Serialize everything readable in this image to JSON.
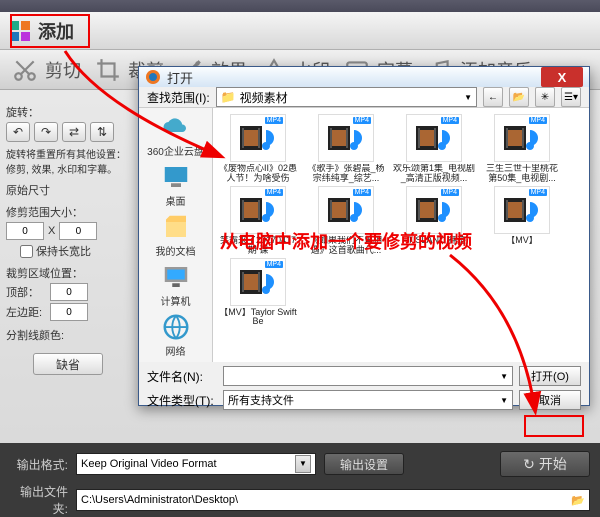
{
  "app": {
    "add_label": "添加",
    "tools": [
      "剪切",
      "裁剪",
      "效果",
      "水印",
      "字幕",
      "添加音乐"
    ],
    "left_panel": {
      "rotate_label": "旋转：",
      "note": "旋转将重置所有其他设置：修剪, 效果, 水印和字幕。",
      "orig_size": "原始尺寸",
      "crop_size": "修剪范围大小：",
      "w": "0",
      "x_sep": "X",
      "h": "0",
      "keep_ratio": "保持长宽比",
      "crop_pos": "裁剪区域位置：",
      "top": "顶部：",
      "top_v": "0",
      "left": "左边距:",
      "left_v": "0",
      "split_color": "分割线颜色:",
      "default_btn": "缺省"
    },
    "bottom": {
      "fmt_label": "输出格式:",
      "fmt_value": "Keep Original Video Format",
      "settings_btn": "输出设置",
      "start_btn": "开始",
      "out_label": "输出文件夹:",
      "out_path": "C:\\Users\\Administrator\\Desktop\\"
    }
  },
  "dialog": {
    "title": "打开",
    "lookin": "查找范围(I):",
    "folder": "视频素材",
    "sidebar": [
      {
        "label": "360企业云盘"
      },
      {
        "label": "桌面"
      },
      {
        "label": "我的文档"
      },
      {
        "label": "计算机"
      },
      {
        "label": "网络"
      }
    ],
    "files": [
      "《废物点心II》02愚人节！为啥受伤",
      "《歌手》张碧晨_杨宗纬纯享_综艺...",
      "欢乐颂第1集_电视剧_高清正版视频...",
      "三生三世十里桃花 第50集_电视剧...",
      "笑霸来了20170417期 课",
      "《如果我们不曾相遇》这首歌曲代...",
      "FTISLAND 神迹",
      "【MV】",
      "【MV】Taylor Swift Be"
    ],
    "filename_label": "文件名(N):",
    "filetype_label": "文件类型(T):",
    "filetype_value": "所有支持文件",
    "open_btn": "打开(O)",
    "cancel_btn": "取消"
  },
  "annotation": "从电脑中添加一个要修剪的视频"
}
